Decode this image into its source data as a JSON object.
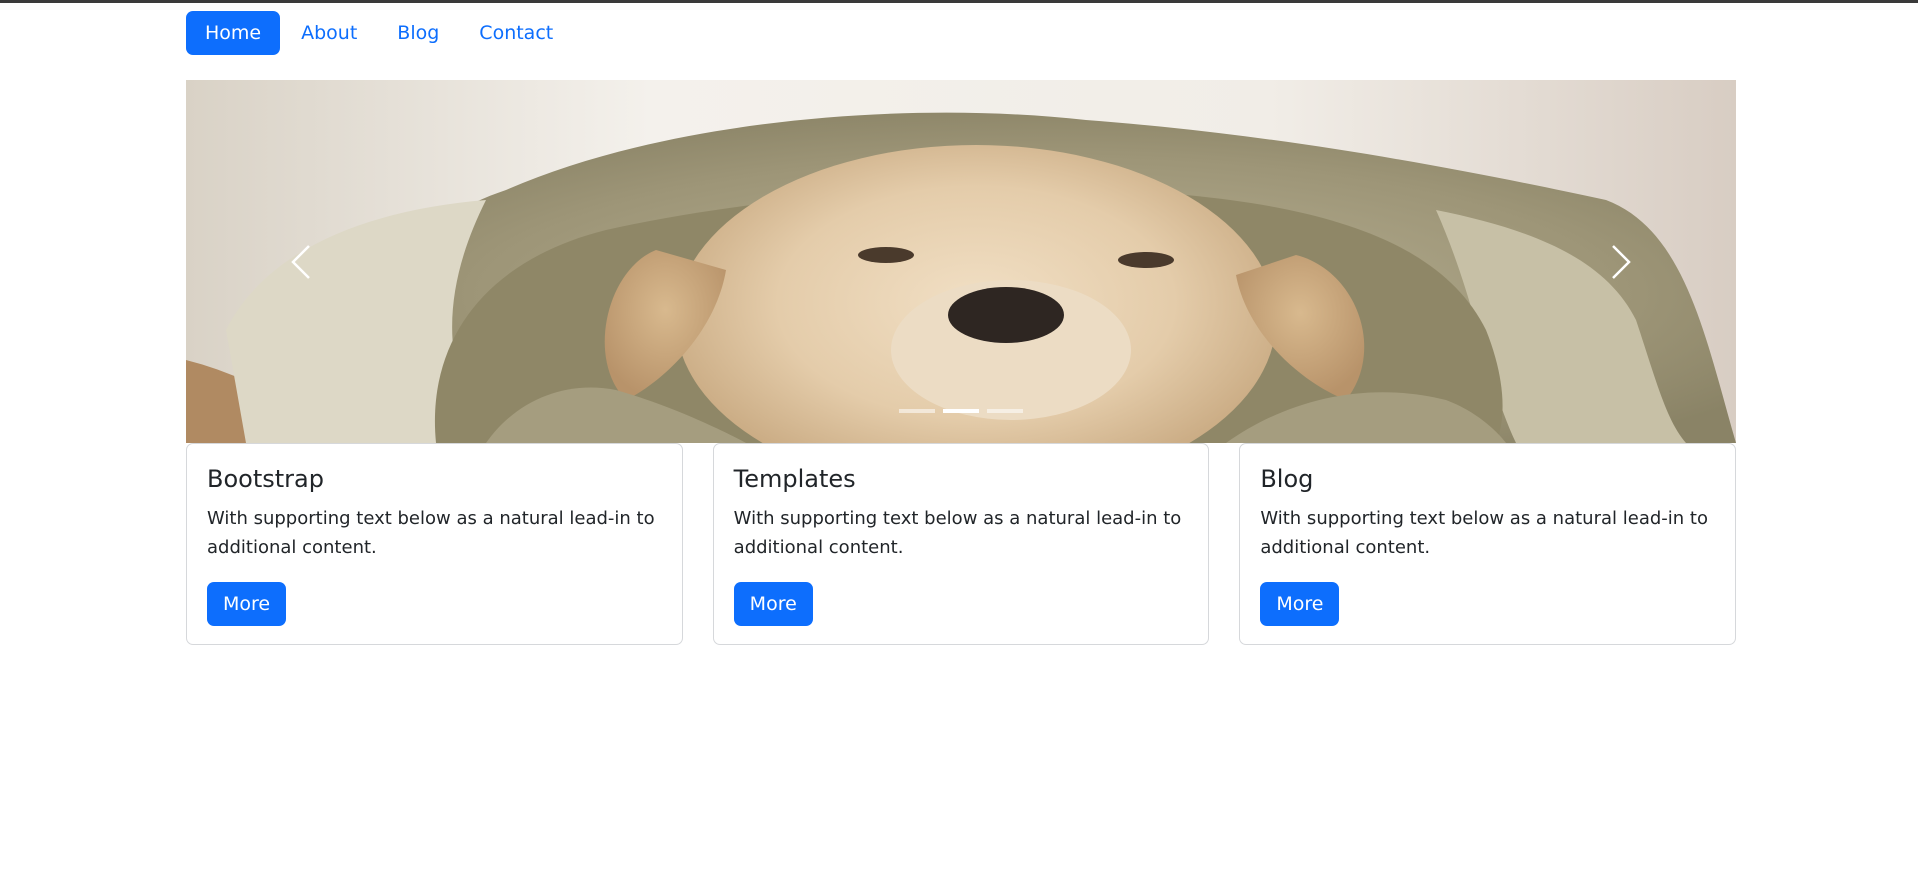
{
  "nav": {
    "items": [
      {
        "label": "Home",
        "active": true
      },
      {
        "label": "About",
        "active": false
      },
      {
        "label": "Blog",
        "active": false
      },
      {
        "label": "Contact",
        "active": false
      }
    ]
  },
  "carousel": {
    "image_subject": "puppy in hood",
    "slide_count": 3,
    "active_slide": 2,
    "prev_icon": "chevron-left-icon",
    "next_icon": "chevron-right-icon"
  },
  "cards": [
    {
      "title": "Bootstrap",
      "text": "With supporting text below as a natural lead-in to additional content.",
      "button": "More"
    },
    {
      "title": "Templates",
      "text": "With supporting text below as a natural lead-in to additional content.",
      "button": "More"
    },
    {
      "title": "Blog",
      "text": "With supporting text below as a natural lead-in to additional content.",
      "button": "More"
    }
  ],
  "colors": {
    "primary": "#0d6efd",
    "border": "#d6d8db",
    "text": "#212529"
  }
}
